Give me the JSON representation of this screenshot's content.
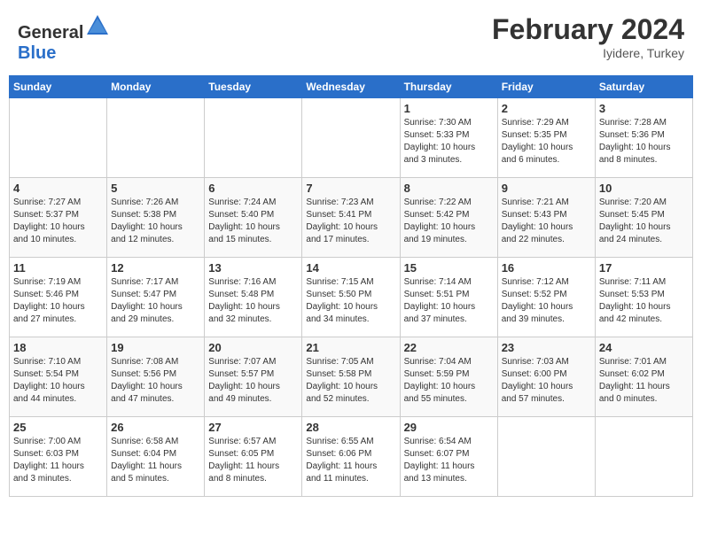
{
  "header": {
    "logo_general": "General",
    "logo_blue": "Blue",
    "title": "February 2024",
    "location": "Iyidere, Turkey"
  },
  "columns": [
    "Sunday",
    "Monday",
    "Tuesday",
    "Wednesday",
    "Thursday",
    "Friday",
    "Saturday"
  ],
  "weeks": [
    [
      {
        "day": "",
        "info": ""
      },
      {
        "day": "",
        "info": ""
      },
      {
        "day": "",
        "info": ""
      },
      {
        "day": "",
        "info": ""
      },
      {
        "day": "1",
        "info": "Sunrise: 7:30 AM\nSunset: 5:33 PM\nDaylight: 10 hours\nand 3 minutes."
      },
      {
        "day": "2",
        "info": "Sunrise: 7:29 AM\nSunset: 5:35 PM\nDaylight: 10 hours\nand 6 minutes."
      },
      {
        "day": "3",
        "info": "Sunrise: 7:28 AM\nSunset: 5:36 PM\nDaylight: 10 hours\nand 8 minutes."
      }
    ],
    [
      {
        "day": "4",
        "info": "Sunrise: 7:27 AM\nSunset: 5:37 PM\nDaylight: 10 hours\nand 10 minutes."
      },
      {
        "day": "5",
        "info": "Sunrise: 7:26 AM\nSunset: 5:38 PM\nDaylight: 10 hours\nand 12 minutes."
      },
      {
        "day": "6",
        "info": "Sunrise: 7:24 AM\nSunset: 5:40 PM\nDaylight: 10 hours\nand 15 minutes."
      },
      {
        "day": "7",
        "info": "Sunrise: 7:23 AM\nSunset: 5:41 PM\nDaylight: 10 hours\nand 17 minutes."
      },
      {
        "day": "8",
        "info": "Sunrise: 7:22 AM\nSunset: 5:42 PM\nDaylight: 10 hours\nand 19 minutes."
      },
      {
        "day": "9",
        "info": "Sunrise: 7:21 AM\nSunset: 5:43 PM\nDaylight: 10 hours\nand 22 minutes."
      },
      {
        "day": "10",
        "info": "Sunrise: 7:20 AM\nSunset: 5:45 PM\nDaylight: 10 hours\nand 24 minutes."
      }
    ],
    [
      {
        "day": "11",
        "info": "Sunrise: 7:19 AM\nSunset: 5:46 PM\nDaylight: 10 hours\nand 27 minutes."
      },
      {
        "day": "12",
        "info": "Sunrise: 7:17 AM\nSunset: 5:47 PM\nDaylight: 10 hours\nand 29 minutes."
      },
      {
        "day": "13",
        "info": "Sunrise: 7:16 AM\nSunset: 5:48 PM\nDaylight: 10 hours\nand 32 minutes."
      },
      {
        "day": "14",
        "info": "Sunrise: 7:15 AM\nSunset: 5:50 PM\nDaylight: 10 hours\nand 34 minutes."
      },
      {
        "day": "15",
        "info": "Sunrise: 7:14 AM\nSunset: 5:51 PM\nDaylight: 10 hours\nand 37 minutes."
      },
      {
        "day": "16",
        "info": "Sunrise: 7:12 AM\nSunset: 5:52 PM\nDaylight: 10 hours\nand 39 minutes."
      },
      {
        "day": "17",
        "info": "Sunrise: 7:11 AM\nSunset: 5:53 PM\nDaylight: 10 hours\nand 42 minutes."
      }
    ],
    [
      {
        "day": "18",
        "info": "Sunrise: 7:10 AM\nSunset: 5:54 PM\nDaylight: 10 hours\nand 44 minutes."
      },
      {
        "day": "19",
        "info": "Sunrise: 7:08 AM\nSunset: 5:56 PM\nDaylight: 10 hours\nand 47 minutes."
      },
      {
        "day": "20",
        "info": "Sunrise: 7:07 AM\nSunset: 5:57 PM\nDaylight: 10 hours\nand 49 minutes."
      },
      {
        "day": "21",
        "info": "Sunrise: 7:05 AM\nSunset: 5:58 PM\nDaylight: 10 hours\nand 52 minutes."
      },
      {
        "day": "22",
        "info": "Sunrise: 7:04 AM\nSunset: 5:59 PM\nDaylight: 10 hours\nand 55 minutes."
      },
      {
        "day": "23",
        "info": "Sunrise: 7:03 AM\nSunset: 6:00 PM\nDaylight: 10 hours\nand 57 minutes."
      },
      {
        "day": "24",
        "info": "Sunrise: 7:01 AM\nSunset: 6:02 PM\nDaylight: 11 hours\nand 0 minutes."
      }
    ],
    [
      {
        "day": "25",
        "info": "Sunrise: 7:00 AM\nSunset: 6:03 PM\nDaylight: 11 hours\nand 3 minutes."
      },
      {
        "day": "26",
        "info": "Sunrise: 6:58 AM\nSunset: 6:04 PM\nDaylight: 11 hours\nand 5 minutes."
      },
      {
        "day": "27",
        "info": "Sunrise: 6:57 AM\nSunset: 6:05 PM\nDaylight: 11 hours\nand 8 minutes."
      },
      {
        "day": "28",
        "info": "Sunrise: 6:55 AM\nSunset: 6:06 PM\nDaylight: 11 hours\nand 11 minutes."
      },
      {
        "day": "29",
        "info": "Sunrise: 6:54 AM\nSunset: 6:07 PM\nDaylight: 11 hours\nand 13 minutes."
      },
      {
        "day": "",
        "info": ""
      },
      {
        "day": "",
        "info": ""
      }
    ]
  ]
}
